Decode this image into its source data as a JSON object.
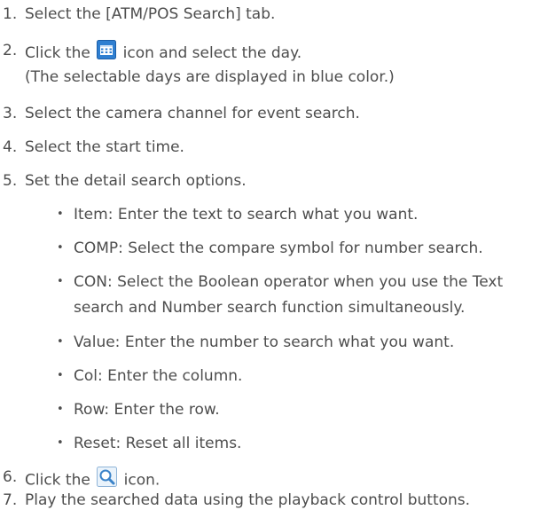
{
  "steps": [
    {
      "number": "1.",
      "text": "Select the [ATM/POS Search] tab."
    },
    {
      "number": "2.",
      "text_before": "Click the",
      "text_after": "icon and select the day.",
      "icon": "calendar-icon",
      "note": "(The selectable days are displayed in blue color.)"
    },
    {
      "number": "3.",
      "text": "Select the camera channel for event search."
    },
    {
      "number": "4.",
      "text": "Select the start time."
    },
    {
      "number": "5.",
      "text": "Set the detail search options."
    },
    {
      "number": "6.",
      "text_before": "Click the",
      "text_after": "icon.",
      "icon": "search-icon"
    },
    {
      "number": "7.",
      "text": "Play the searched data using the playback control buttons."
    }
  ],
  "options": [
    {
      "line1": "Item: Enter the text to search what you want."
    },
    {
      "line1": "COMP: Select the compare symbol for number search."
    },
    {
      "line1": "CON: Select the Boolean operator when you use the Text",
      "line2": "search and Number search function simultaneously."
    },
    {
      "line1": "Value: Enter the number to search what you want."
    },
    {
      "line1": "Col: Enter the column."
    },
    {
      "line1": "Row: Enter the row."
    },
    {
      "line1": "Reset: Reset all items."
    }
  ],
  "bullet_glyph": "•",
  "colors": {
    "text": "#4d4d4d",
    "calendar_icon_blue": "#2f7fd1",
    "search_icon_blue": "#3b83c9"
  }
}
